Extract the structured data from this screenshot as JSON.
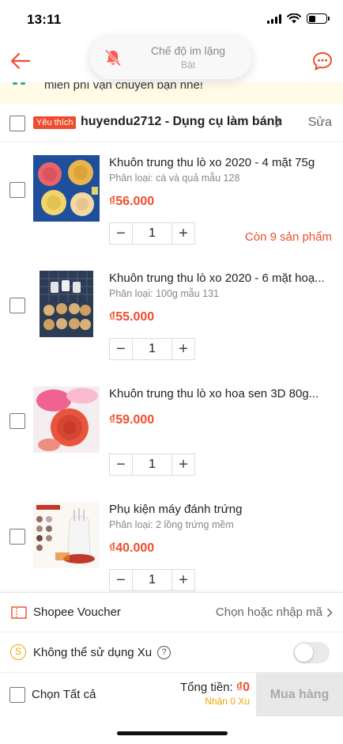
{
  "status_bar": {
    "time": "13:11"
  },
  "silent_mode": {
    "title": "Chế độ im lặng",
    "subtitle": "Bật"
  },
  "notice": {
    "text": "miễn phí vận chuyển bạn nhé!"
  },
  "shop": {
    "badge": "Yêu thích",
    "name": "huyendu2712 - Dụng cụ làm bánh",
    "edit_label": "Sửa"
  },
  "items": [
    {
      "title": "Khuôn trung thu lò xo 2020 - 4 mặt 75g",
      "variant": "Phân loại: cá và quả mẫu 128",
      "price": "₫56.000",
      "quantity": "1",
      "stock_note": "Còn 9 sản phẩm"
    },
    {
      "title": "Khuôn trung thu lò xo 2020 - 6 mặt hoạ...",
      "variant": "Phân loại: 100g mẫu 131",
      "price": "₫55.000",
      "quantity": "1"
    },
    {
      "title": "Khuôn trung thu lò xo hoa sen 3D 80g...",
      "variant": "",
      "price": "₫59.000",
      "quantity": "1"
    },
    {
      "title": "Phụ kiện máy đánh trứng",
      "variant": "Phân loại: 2 lồng trứng mềm",
      "price": "₫40.000",
      "quantity": "1"
    }
  ],
  "qty_controls": {
    "minus": "−",
    "plus": "+"
  },
  "voucher": {
    "label": "Shopee Voucher",
    "action": "Chọn hoặc nhập mã"
  },
  "coins": {
    "label": "Không thể sử dụng Xu",
    "coin_symbol": "S",
    "help_symbol": "?"
  },
  "checkout": {
    "select_all": "Chọn Tất cả",
    "total_label": "Tổng tiền:",
    "total_value": "₫0",
    "coins_earn": "Nhận 0 Xu",
    "buy_label": "Mua hàng"
  },
  "colors": {
    "accent": "#ee4d2d",
    "coin": "#f0a500",
    "notice_bg": "#fffbe6"
  }
}
